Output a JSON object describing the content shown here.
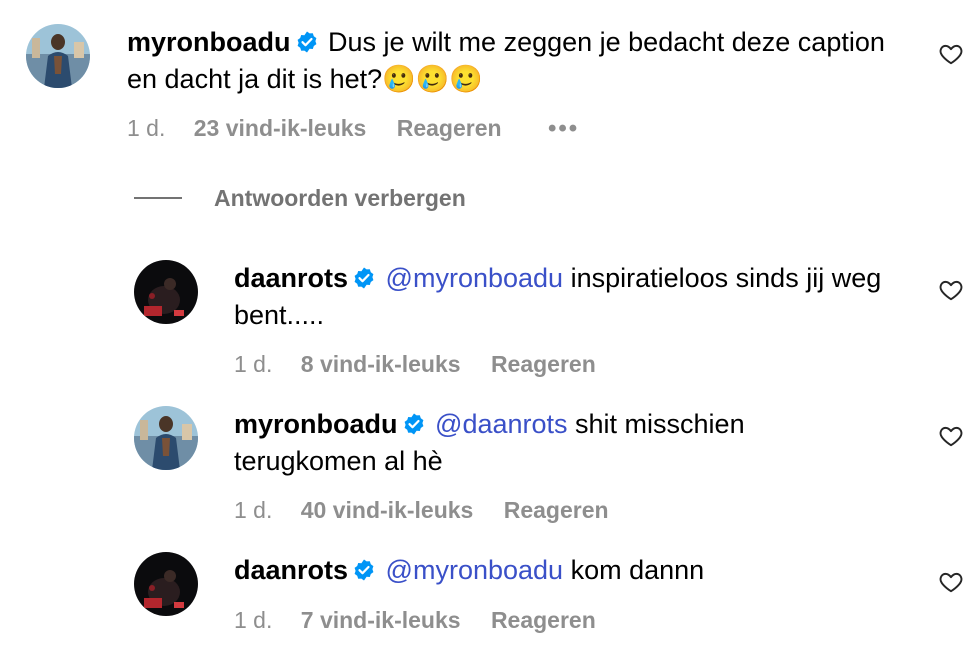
{
  "comments": [
    {
      "username": "myronboadu",
      "mention": "",
      "text": "Dus je wilt me zeggen je bedacht deze caption en dacht ja dit is het?🥲🥲🥲",
      "time": "1 d.",
      "likes": "23 vind-ik-leuks",
      "reply": "Reageren",
      "more": "•••"
    },
    {
      "username": "daanrots",
      "mention": "@myronboadu",
      "text": "inspiratieloos sinds jij weg bent.....",
      "time": "1 d.",
      "likes": "8 vind-ik-leuks",
      "reply": "Reageren"
    },
    {
      "username": "myronboadu",
      "mention": "@daanrots",
      "text": "shit misschien terugkomen al hè",
      "time": "1 d.",
      "likes": "40 vind-ik-leuks",
      "reply": "Reageren"
    },
    {
      "username": "daanrots",
      "mention": "@myronboadu",
      "text": "kom dannn",
      "time": "1 d.",
      "likes": "7 vind-ik-leuks",
      "reply": "Reageren"
    }
  ],
  "hide_replies_label": "Antwoorden verbergen",
  "colors": {
    "mention": "#3a50c8",
    "meta": "#8e8e8e",
    "verified": "#0095f6"
  },
  "icons": {
    "verified": "verified-badge-icon",
    "heart": "heart-outline-icon",
    "more": "more-options-icon"
  }
}
